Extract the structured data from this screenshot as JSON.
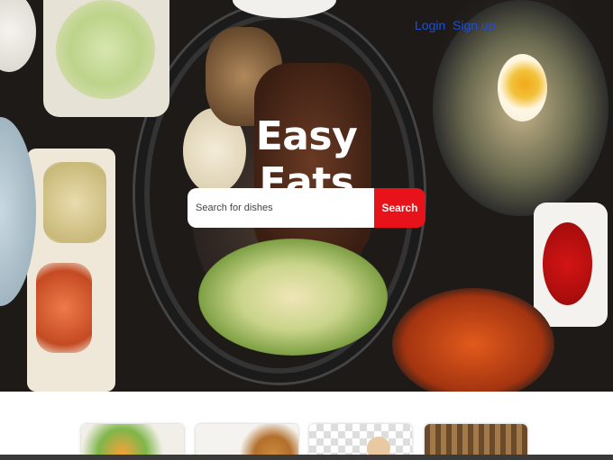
{
  "header": {
    "login_label": "Login",
    "signup_label": "Sign up"
  },
  "hero": {
    "title": "Easy Eats",
    "search_placeholder": "Search for dishes",
    "search_button_label": "Search"
  },
  "colors": {
    "link": "#1e4fd6",
    "search_button": "#e8131a",
    "title": "#ffffff"
  },
  "featured": {
    "cards": [
      "food-photo",
      "food-photo",
      "food-photo",
      "food-photo"
    ]
  }
}
